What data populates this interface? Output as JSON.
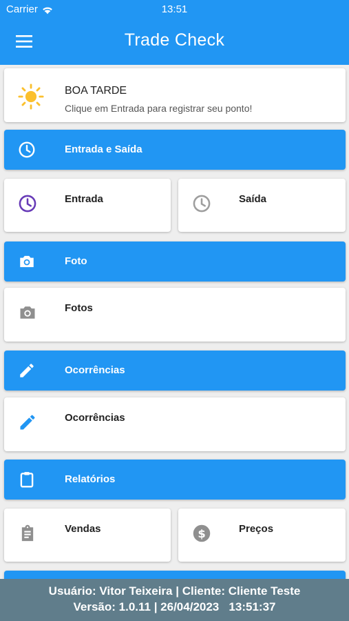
{
  "status_bar": {
    "carrier": "Carrier",
    "time": "13:51"
  },
  "app_bar": {
    "title": "Trade Check",
    "menu_icon": "menu-icon"
  },
  "greeting": {
    "title": "BOA TARDE",
    "subtitle": "Clique em Entrada para registrar seu ponto!",
    "icon": "sun-icon"
  },
  "sections": {
    "entrada_saida": {
      "label": "Entrada e Saída",
      "icon": "clock-icon"
    },
    "foto": {
      "label": "Foto",
      "icon": "camera-icon"
    },
    "ocorrencias": {
      "label": "Ocorrências",
      "icon": "pencil-icon"
    },
    "relatorios": {
      "label": "Relatórios",
      "icon": "clipboard-icon"
    }
  },
  "items": {
    "entrada": {
      "label": "Entrada",
      "icon": "clock-icon"
    },
    "saida": {
      "label": "Saída",
      "icon": "clock-icon"
    },
    "fotos": {
      "label": "Fotos",
      "icon": "camera-icon"
    },
    "ocorrencias": {
      "label": "Ocorrências",
      "icon": "pencil-icon"
    },
    "vendas": {
      "label": "Vendas",
      "icon": "assignment-icon"
    },
    "precos": {
      "label": "Preços",
      "icon": "dollar-coin-icon"
    }
  },
  "footer": {
    "user_line": "Usuário: Vitor Teixeira | Cliente: Cliente Teste",
    "version_line": "Versão: 1.0.11 | 26/04/2023   13:51:37"
  },
  "colors": {
    "primary": "#2196f3",
    "footer": "#607d8b",
    "sun": "#fbc02d",
    "entrada_icon": "#673ab7",
    "grey_icon": "#9e9e9e",
    "pencil_blue": "#2196f3"
  }
}
